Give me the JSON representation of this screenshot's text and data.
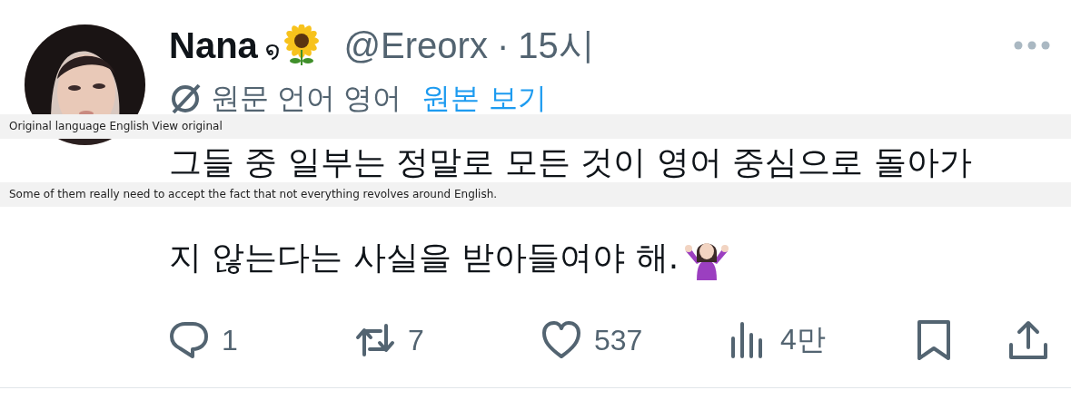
{
  "author": {
    "name": "Nana",
    "symbol": "໑",
    "handle": "@Ereorx",
    "separator": "·",
    "time": "15시"
  },
  "translation": {
    "label": "원문 언어 영어",
    "link": "원본 보기"
  },
  "body": {
    "lines": [
      "그들 중 일부는 정말로 모든 것이 영어 중심으로 돌아가",
      "지 않는다는 사실을 받아들여야 해."
    ]
  },
  "actions": [
    {
      "kind": "reply",
      "count": "1"
    },
    {
      "kind": "repost",
      "count": "7"
    },
    {
      "kind": "like",
      "count": "537"
    },
    {
      "kind": "views",
      "count": "4만"
    },
    {
      "kind": "bookmark"
    },
    {
      "kind": "share"
    }
  ],
  "overlays": [
    {
      "text": "Original language English View original"
    },
    {
      "text": "Some of them really need to accept the fact that not everything revolves around English."
    }
  ]
}
